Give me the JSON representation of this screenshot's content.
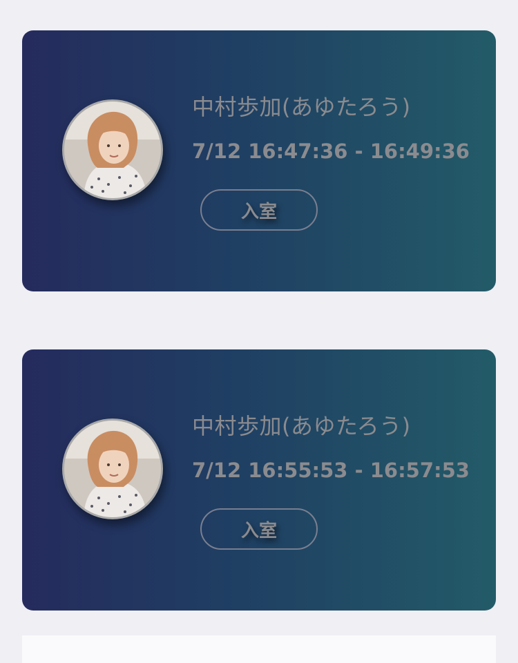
{
  "sessions": [
    {
      "name": "中村歩加(あゆたろう)",
      "time": "7/12 16:47:36 - 16:49:36",
      "button_label": "入室",
      "avatar_icon": "avatar-photo"
    },
    {
      "name": "中村歩加(あゆたろう)",
      "time": "7/12 16:55:53 - 16:57:53",
      "button_label": "入室",
      "avatar_icon": "avatar-photo"
    }
  ],
  "colors": {
    "background": "#efeff4",
    "card_gradient_start": "#252b5d",
    "card_gradient_end": "#235b68",
    "text": "#8b8b8f"
  }
}
